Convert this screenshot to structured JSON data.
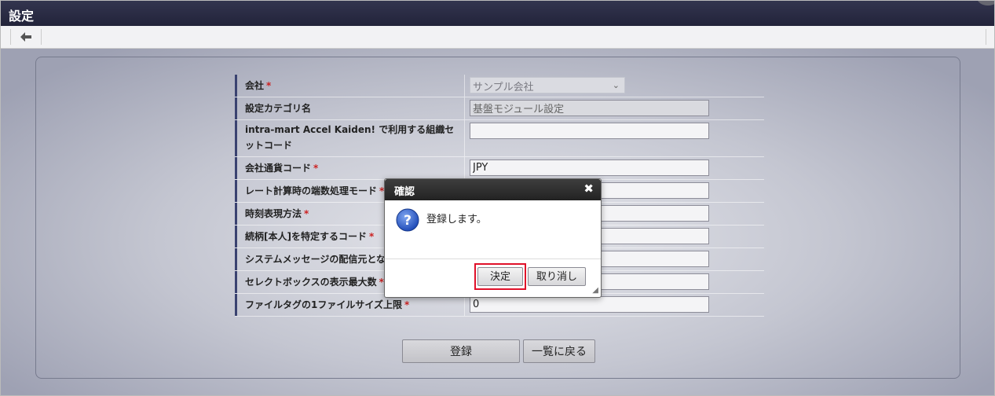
{
  "app": {
    "title": "設定"
  },
  "form": {
    "rows": [
      {
        "label": "会社",
        "required": "*",
        "type": "select",
        "value": "サンプル会社"
      },
      {
        "label": "設定カテゴリ名",
        "required": "",
        "type": "readonly",
        "value": "基盤モジュール設定"
      },
      {
        "label": "intra-mart Accel Kaiden! で利用する組織セットコード",
        "required": "",
        "type": "input",
        "value": ""
      },
      {
        "label": "会社通貨コード",
        "required": "*",
        "type": "input",
        "value": "JPY"
      },
      {
        "label": "レート計算時の端数処理モード",
        "required": "*",
        "type": "input",
        "value": ""
      },
      {
        "label": "時刻表現方法",
        "required": "*",
        "type": "input",
        "value": ""
      },
      {
        "label": "続柄[本人]を特定するコード",
        "required": "*",
        "type": "input",
        "value": ""
      },
      {
        "label": "システムメッセージの配信元となる",
        "required": "",
        "type": "input",
        "value": ""
      },
      {
        "label": "セレクトボックスの表示最大数",
        "required": "*",
        "type": "input",
        "value": ""
      },
      {
        "label": "ファイルタグの1ファイルサイズ上限",
        "required": "*",
        "type": "input",
        "value": "0"
      }
    ]
  },
  "buttons": {
    "register": "登録",
    "back_to_list": "一覧に戻る"
  },
  "dialog": {
    "title": "確認",
    "message": "登録します。",
    "ok": "決定",
    "cancel": "取り消し",
    "close_symbol": "✖",
    "icon": "question-icon"
  },
  "colors": {
    "titlebar": "#22233a",
    "highlight": "#e0102a",
    "label_bar": "#3a4270"
  }
}
